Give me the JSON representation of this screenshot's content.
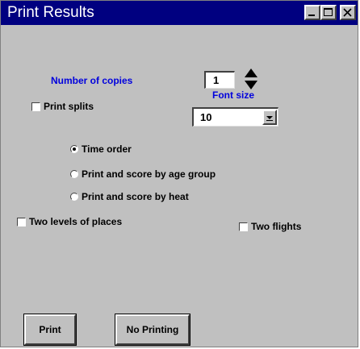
{
  "window": {
    "title": "Print Results",
    "controls": {
      "minimize": "minimize-icon",
      "maximize": "maximize-icon",
      "close": "close-icon"
    }
  },
  "copies": {
    "label": "Number of copies",
    "value": "1"
  },
  "font": {
    "label": "Font size",
    "value": "10"
  },
  "options": {
    "print_splits": {
      "label": "Print splits",
      "checked": false
    },
    "two_levels": {
      "label": "Two levels of places",
      "checked": false
    },
    "two_flights": {
      "label": "Two flights",
      "checked": false
    }
  },
  "order": {
    "selected": "Time order",
    "items": [
      "Time order",
      "Print and score by age group",
      "Print and score by heat"
    ]
  },
  "buttons": {
    "print": "Print",
    "no_printing": "No Printing"
  },
  "colors": {
    "titlebar": "#000080",
    "accent_label": "#0000dd",
    "face": "#c0c0c0"
  }
}
